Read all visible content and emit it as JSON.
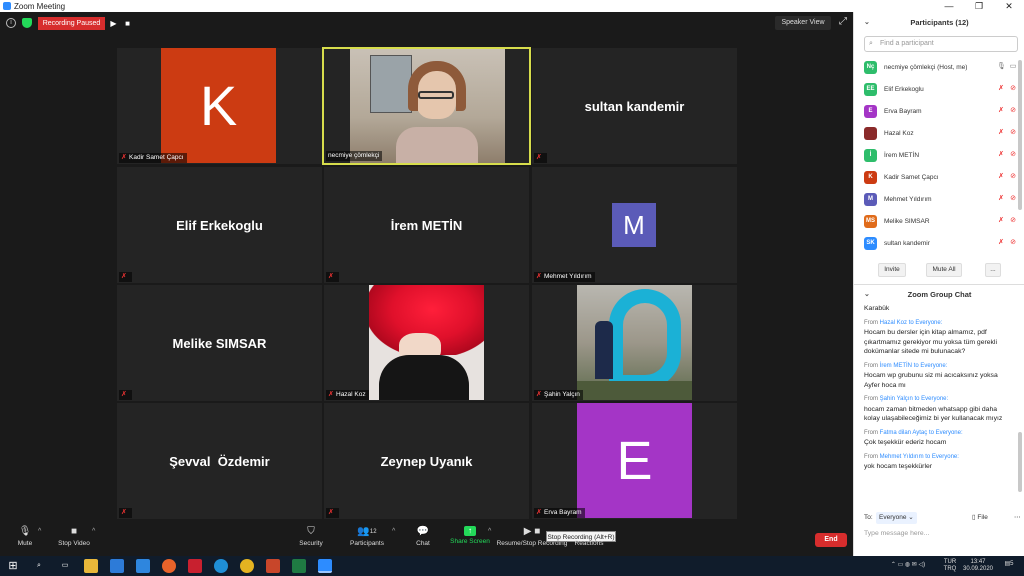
{
  "window": {
    "title": "Zoom Meeting"
  },
  "topbar": {
    "recording_label": "Recording Paused",
    "view_label": "Speaker View"
  },
  "tiles": {
    "kadir": {
      "label": "Kadir Samet Çapcı",
      "avatar_letter": "K",
      "avatar_color": "#cc3b12"
    },
    "necmiye": {
      "label": "necmiye çömlekçi"
    },
    "sultan": {
      "name": "sultan kandemir"
    },
    "elif": {
      "name": "Elif Erkekoglu"
    },
    "irem": {
      "name": "İrem METİN"
    },
    "mehmet": {
      "label": "Mehmet Yıldırım",
      "avatar_letter": "M",
      "avatar_color": "#5b5bb8"
    },
    "melike": {
      "name": "Melike SIMSAR"
    },
    "hazal": {
      "label": "Hazal Koz"
    },
    "sahin": {
      "label": "Şahin Yalçın"
    },
    "sevval": {
      "name": "Şevval  Özdemir"
    },
    "zeynep": {
      "name": "Zeynep Uyanık"
    },
    "erva": {
      "label": "Erva Bayram",
      "avatar_letter": "E",
      "avatar_color": "#a435c6"
    }
  },
  "toolbar": {
    "mute": "Mute",
    "stop_video": "Stop Video",
    "security": "Security",
    "participants": "Participants",
    "participants_count": "12",
    "chat": "Chat",
    "share_screen": "Share Screen",
    "record": "Resume/Stop Recording",
    "reactions": "Reactions",
    "tooltip": "Stop Recording (Alt+R)",
    "end": "End"
  },
  "participants_panel": {
    "title": "Participants (12)",
    "search_placeholder": "Find a participant",
    "people": [
      {
        "initials": "Nç",
        "name": "necmiye çömlekçi (Host, me)",
        "color": "#2ebd6b"
      },
      {
        "initials": "EE",
        "name": "Elif Erkekoglu",
        "color": "#2ebd6b"
      },
      {
        "initials": "E",
        "name": "Erva Bayram",
        "color": "#a435c6"
      },
      {
        "initials": "",
        "name": "Hazal Koz",
        "color": "#8a2a2a"
      },
      {
        "initials": "İ",
        "name": "İrem METİN",
        "color": "#2ebd6b"
      },
      {
        "initials": "K",
        "name": "Kadir Samet Çapcı",
        "color": "#cc3b12"
      },
      {
        "initials": "M",
        "name": "Mehmet Yıldırım",
        "color": "#5b5bb8"
      },
      {
        "initials": "MS",
        "name": "Melike SIMSAR",
        "color": "#e06b1a"
      },
      {
        "initials": "SK",
        "name": "sultan kandemir",
        "color": "#2d8cff"
      }
    ],
    "invite": "Invite",
    "mute_all": "Mute All",
    "more": "..."
  },
  "chat_panel": {
    "title": "Zoom Group Chat",
    "first_line": "Karabük",
    "messages": [
      {
        "from_prefix": "From",
        "from": "Hazal Koz",
        "to": "to Everyone:",
        "text": "Hocam bu dersler için kitap almamız, pdf çıkartmamız gerekiyor mu yoksa tüm gerekli dokümanlar sitede mi bulunacak?"
      },
      {
        "from_prefix": "From",
        "from": "İrem METİN",
        "to": "to Everyone:",
        "text": "Hocam wp grubunu siz mi acıcaksınız yoksa Ayfer hoca mı"
      },
      {
        "from_prefix": "From",
        "from": "Şahin Yalçın",
        "to": "to Everyone:",
        "text": "hocam zaman bitmeden whatsapp gibi daha kolay ulaşabileceğimiz bi yer kullanacak mıyız"
      },
      {
        "from_prefix": "From",
        "from": "Fatma dilan Aytaç",
        "to": "to Everyone:",
        "text": "Çok teşekkür  ederiz hocam"
      },
      {
        "from_prefix": "From",
        "from": "Mehmet Yıldırım",
        "to": "to Everyone:",
        "text": "yok hocam teşekkürler"
      }
    ],
    "to_label": "To:",
    "to_value": "Everyone",
    "file_label": "File",
    "input_placeholder": "Type message here..."
  },
  "taskbar": {
    "lang": "TUR",
    "lang2": "TRQ",
    "time": "13:47",
    "date": "30.09.2020",
    "notif": "5"
  }
}
